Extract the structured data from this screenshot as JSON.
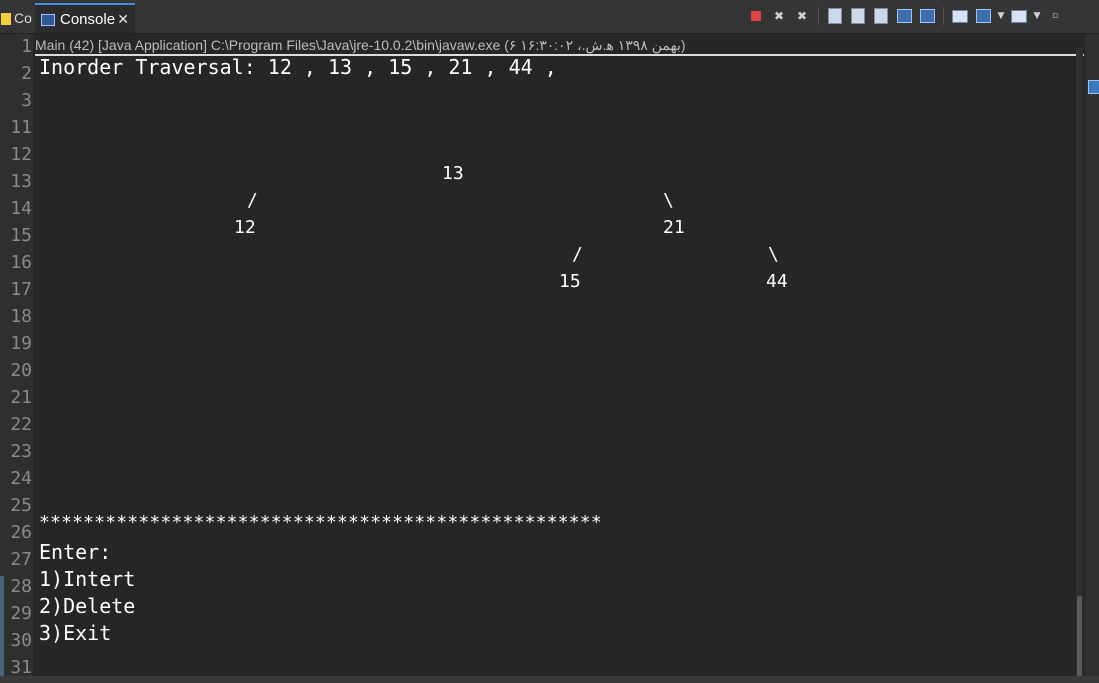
{
  "editor_tab": {
    "label": "Co"
  },
  "console_tab": {
    "label": "Console",
    "close_glyph": "✕"
  },
  "console_header": "Main (42) [Java Application] C:\\Program Files\\Java\\jre-10.0.2\\bin\\javaw.exe (۶ بهمن ۱۳۹۸ ه‍.ش.، ۱۶:۳۰:۰۲)",
  "gutter_lines": [
    "1",
    "2",
    "3",
    "11",
    "12",
    "13",
    "14",
    "15",
    "16",
    "17",
    "18",
    "19",
    "20",
    "21",
    "22",
    "23",
    "24",
    "25",
    "26",
    "27",
    "28",
    "29",
    "30",
    "31"
  ],
  "output": {
    "traversal": "Inorder Traversal: 12 , 13 , 15 , 21 , 44 ,",
    "tree": {
      "root": "13",
      "left_branch": "/",
      "right_branch": "\\",
      "left_child": "12",
      "right_child": "21",
      "rl_branch": "/",
      "rr_branch": "\\",
      "rl_child": "15",
      "rr_child": "44"
    },
    "separator": "***************************************************",
    "menu": {
      "prompt": "Enter:",
      "items": [
        "1)Intert",
        "2)Delete",
        "3)Exit"
      ]
    }
  },
  "toolbar_icons": [
    "terminate-icon",
    "remove-launch-icon",
    "remove-all-icon",
    "scroll-lock-icon",
    "word-wrap-icon",
    "show-on-output-icon",
    "show-on-error-icon",
    "pin-console-icon",
    "display-console-icon",
    "new-console-icon",
    "minimize-icon"
  ],
  "colors": {
    "background": "#262626",
    "text": "#ffffff",
    "terminate_red": "#e04444",
    "tab_accent": "#4b8ad8"
  }
}
